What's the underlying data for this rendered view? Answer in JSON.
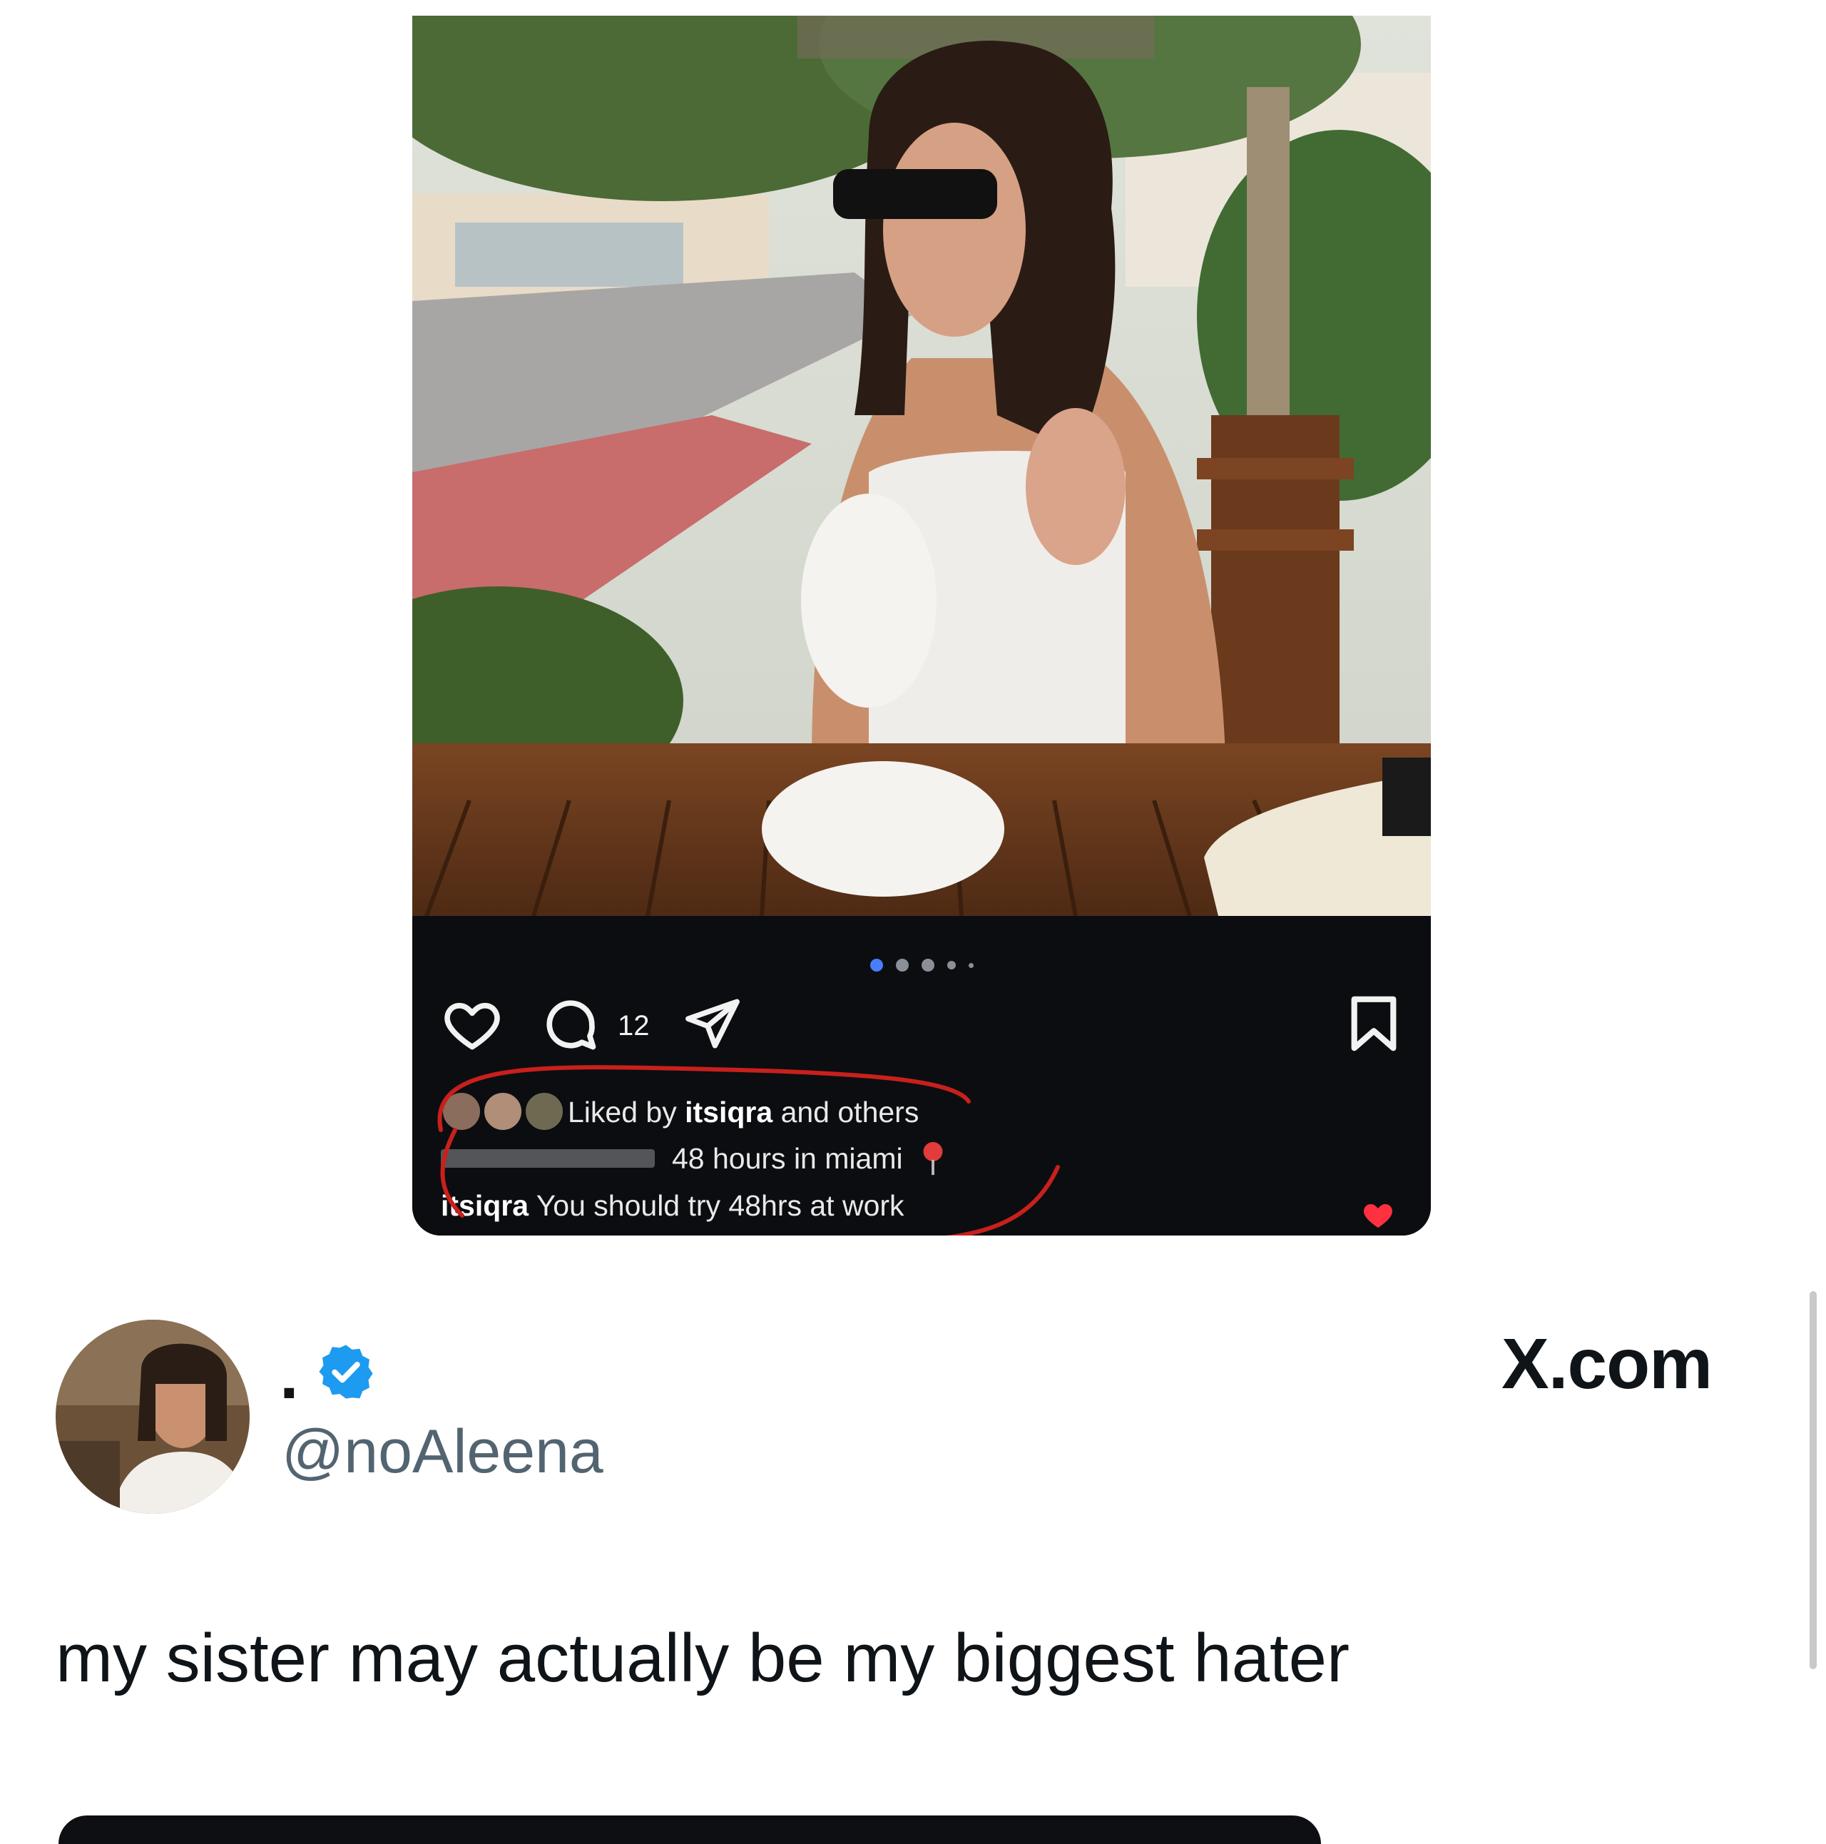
{
  "instagram_post": {
    "carousel": {
      "total": 5,
      "active_index": 0
    },
    "comment_count": "12",
    "likes": {
      "prefix": "Liked by",
      "user": "itsiqra",
      "suffix": "and others"
    },
    "caption": "48 hours in miami",
    "comment": {
      "user": "itsiqra",
      "text": "You should try 48hrs at work"
    },
    "colors": {
      "background": "#0c0d10",
      "annotation_red": "#c8201c",
      "like_red": "#ff3040"
    }
  },
  "tweet": {
    "display_name": ".",
    "handle": "@noAleena",
    "text": "my sister may actually be my biggest hater",
    "verified": true,
    "verified_color": "#1d9bf0"
  },
  "branding": {
    "site": "X.com"
  }
}
